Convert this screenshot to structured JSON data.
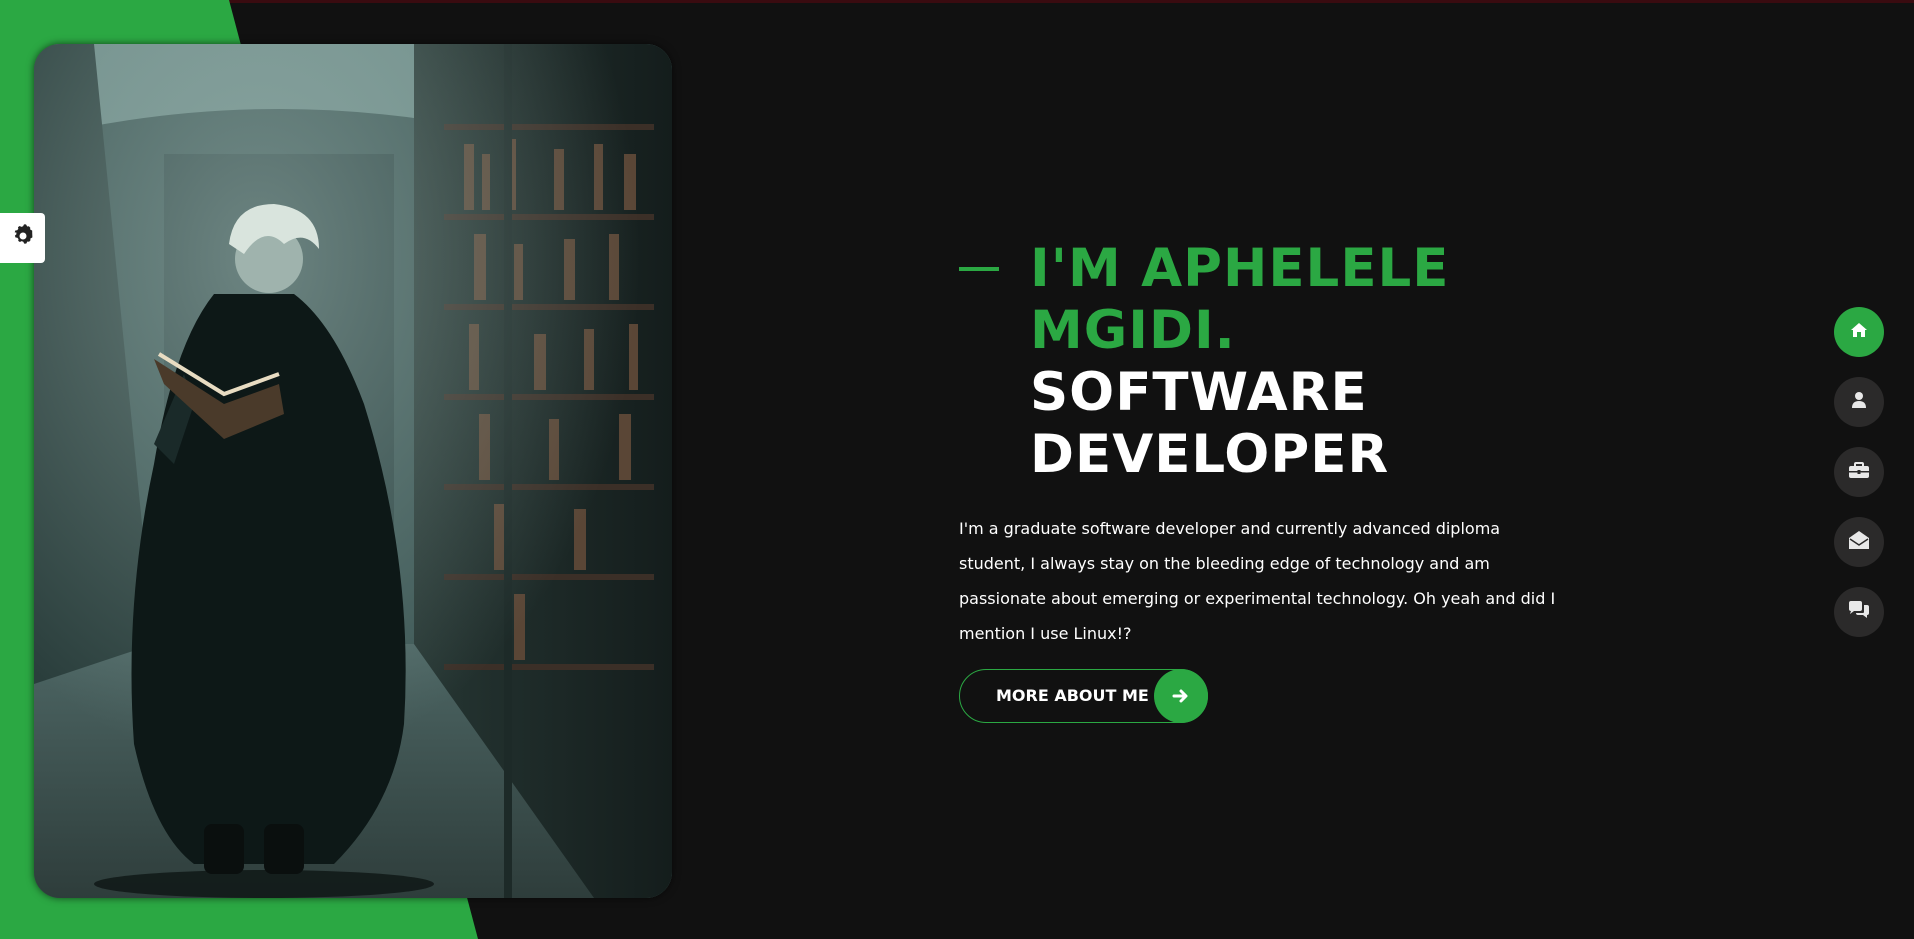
{
  "colors": {
    "accent": "#2ba843",
    "background": "#111111",
    "nav_button": "#2b2a2a",
    "text": "#ffffff"
  },
  "hero": {
    "image_alt": "Figure in a dark cloak holding an open book, walking through a library aisle"
  },
  "settings": {
    "icon": "gear-icon"
  },
  "intro": {
    "name_line1": "I'M APHELELE",
    "name_line2": "MGIDI.",
    "role_line1": "SOFTWARE",
    "role_line2": "DEVELOPER",
    "description": "I'm a graduate software developer and currently advanced diploma student, I always stay on the bleeding edge of technology and am passionate about emerging or experimental technology. Oh yeah and did I mention I use Linux!?"
  },
  "cta": {
    "label": "MORE ABOUT ME",
    "icon": "arrow-right-icon"
  },
  "nav": {
    "items": [
      {
        "icon": "home-icon",
        "active": true
      },
      {
        "icon": "user-icon",
        "active": false
      },
      {
        "icon": "briefcase-icon",
        "active": false
      },
      {
        "icon": "envelope-open-icon",
        "active": false
      },
      {
        "icon": "comments-icon",
        "active": false
      }
    ]
  }
}
